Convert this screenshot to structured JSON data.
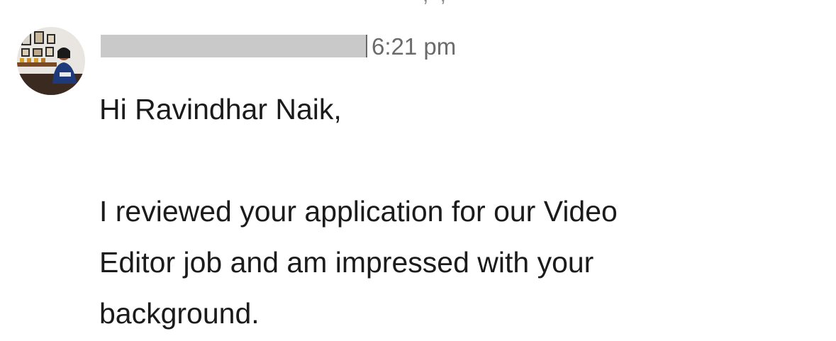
{
  "message": {
    "sender": {
      "name": "",
      "avatar_icon": "profile-photo"
    },
    "time": "6:21 pm",
    "body": {
      "greeting": "Hi Ravindhar Naik,",
      "line1": "I reviewed your application for our Video",
      "line2": "Editor job and am impressed with your",
      "line3": "background."
    }
  },
  "top_fragment": ", ,",
  "colors": {
    "text": "#1b1b1b",
    "timestamp": "#6b6b6b",
    "redaction": "#c9c9c9"
  }
}
